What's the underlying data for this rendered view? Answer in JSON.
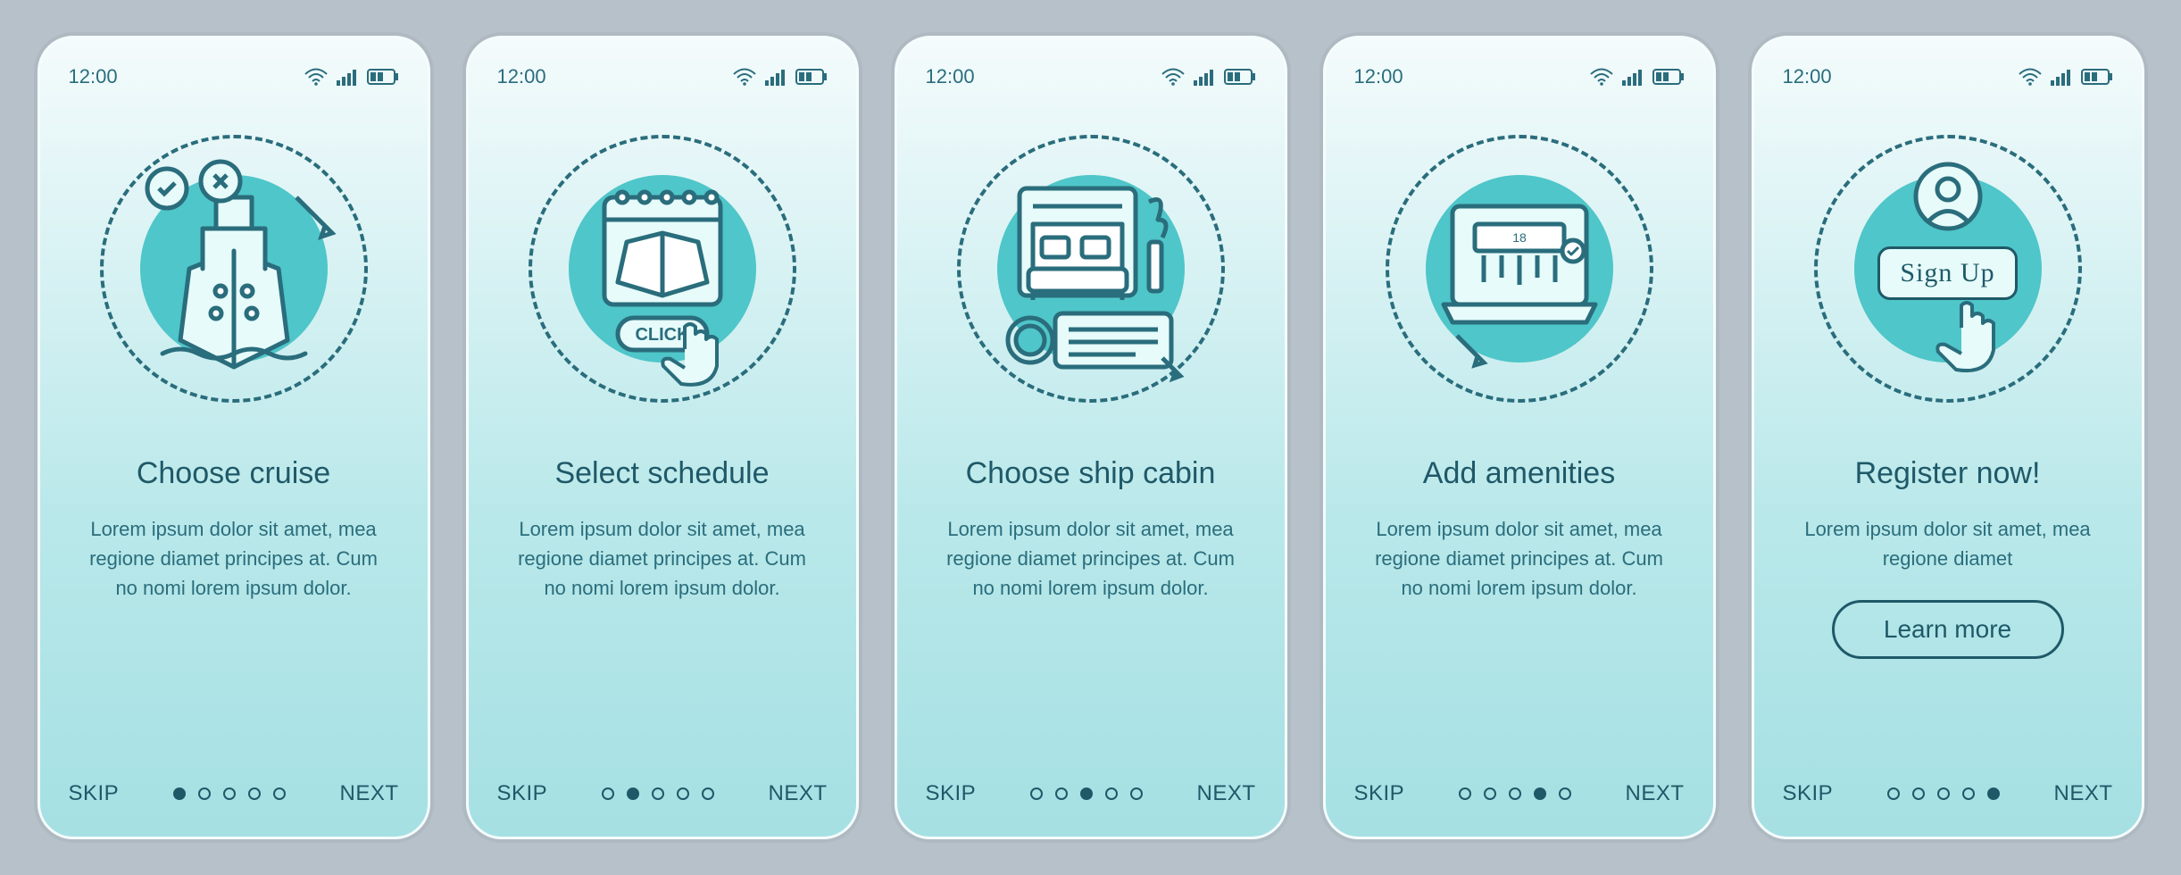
{
  "status_time": "12:00",
  "colors": {
    "stroke": "#2a6d7c",
    "accent": "#4fc6c9",
    "text": "#1f5968"
  },
  "screens": [
    {
      "icon": "cruise-ship-icon",
      "title": "Choose cruise",
      "body": "Lorem ipsum dolor sit amet, mea regione diamet principes at. Cum no nomi lorem ipsum dolor.",
      "skip": "SKIP",
      "next": "NEXT",
      "activeDot": 0,
      "cta": null
    },
    {
      "icon": "calendar-click-icon",
      "title": "Select schedule",
      "body": "Lorem ipsum dolor sit amet, mea regione diamet principes at. Cum no nomi lorem ipsum dolor.",
      "skip": "SKIP",
      "next": "NEXT",
      "activeDot": 1,
      "cta": null
    },
    {
      "icon": "cabin-bed-icon",
      "title": "Choose ship cabin",
      "body": "Lorem ipsum dolor sit amet, mea regione diamet principes at. Cum no nomi lorem ipsum dolor.",
      "skip": "SKIP",
      "next": "NEXT",
      "activeDot": 2,
      "cta": null
    },
    {
      "icon": "laptop-amenity-icon",
      "title": "Add amenities",
      "body": "Lorem ipsum dolor sit amet, mea regione diamet principes at. Cum no nomi lorem ipsum dolor.",
      "skip": "SKIP",
      "next": "NEXT",
      "activeDot": 3,
      "cta": null
    },
    {
      "icon": "signup-hand-icon",
      "title": "Register now!",
      "body": "Lorem ipsum dolor sit amet, mea regione diamet",
      "skip": "SKIP",
      "next": "NEXT",
      "activeDot": 4,
      "cta": "Learn more",
      "signup_label": "Sign Up"
    }
  ],
  "click_label": "CLICK",
  "amenity_value": "18"
}
